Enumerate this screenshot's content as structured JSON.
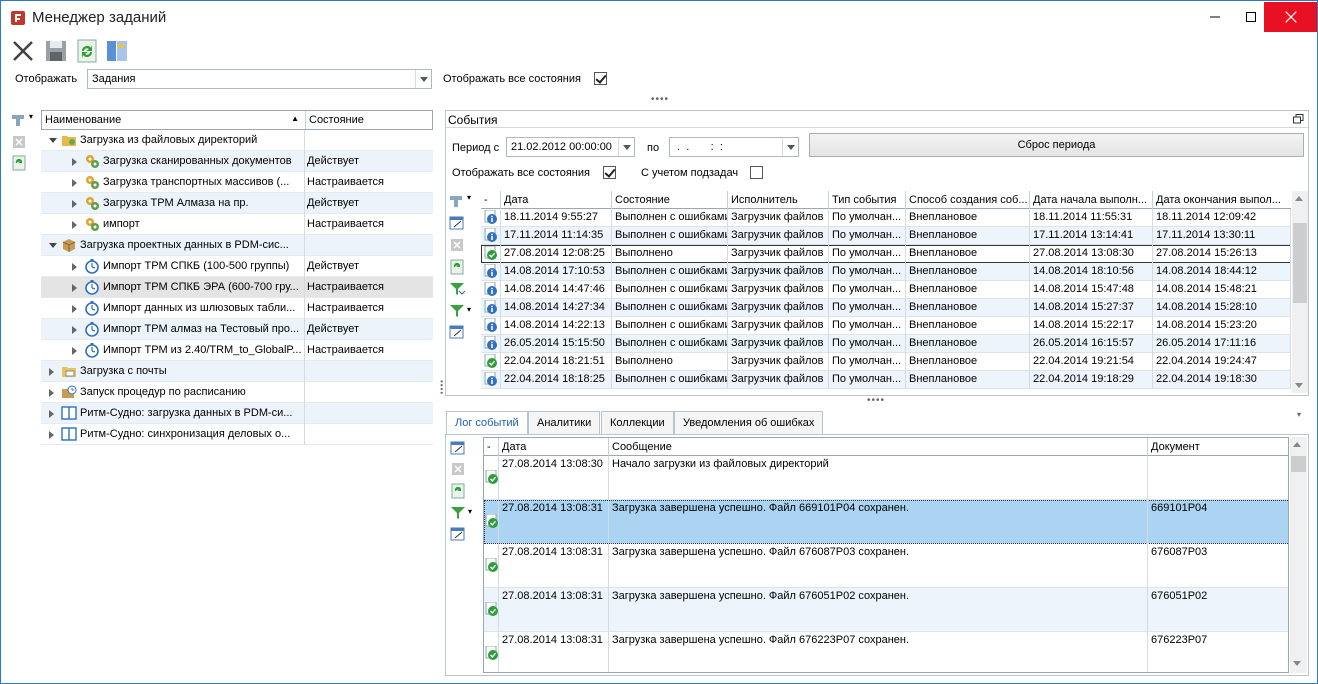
{
  "window": {
    "title": "Менеджер заданий"
  },
  "toolbar": {
    "items": [
      {
        "name": "delete-icon"
      },
      {
        "name": "save-icon"
      },
      {
        "name": "refresh-icon"
      },
      {
        "name": "layout-icon"
      }
    ]
  },
  "display": {
    "label": "Отображать",
    "value": "Задания",
    "all_states_label": "Отображать все состояния",
    "all_states_checked": true
  },
  "tree": {
    "columns": [
      "Наименование",
      "Состояние"
    ],
    "rows": [
      {
        "level": 0,
        "expanded": true,
        "icon": "folder-gear-icon",
        "name": "Загрузка из файловых директорий",
        "state": ""
      },
      {
        "level": 1,
        "expanded": false,
        "icon": "gears-icon",
        "name": "Загрузка сканированных документов",
        "state": "Действует"
      },
      {
        "level": 1,
        "expanded": false,
        "icon": "gears-icon",
        "name": "Загрузка транспортных массивов (...",
        "state": "Настраивается"
      },
      {
        "level": 1,
        "expanded": false,
        "icon": "gears-icon",
        "name": "Загрузка ТРМ Алмаза на пр.",
        "state": "Действует"
      },
      {
        "level": 1,
        "expanded": false,
        "icon": "gears-icon",
        "name": "импорт",
        "state": "Настраивается"
      },
      {
        "level": 0,
        "expanded": true,
        "icon": "package-icon",
        "name": "Загрузка проектных данных в PDM-сис...",
        "state": ""
      },
      {
        "level": 1,
        "expanded": false,
        "icon": "stopwatch-icon",
        "name": "Импорт  ТРМ СПКБ (100-500 группы)",
        "state": "Действует"
      },
      {
        "level": 1,
        "expanded": false,
        "icon": "stopwatch-icon",
        "name": "Импорт  ТРМ СПКБ ЭРА (600-700 гру...",
        "state": "Настраивается",
        "selected": true
      },
      {
        "level": 1,
        "expanded": false,
        "icon": "stopwatch-icon",
        "name": "Импорт данных из шлюзовых табли...",
        "state": "Настраивается"
      },
      {
        "level": 1,
        "expanded": false,
        "icon": "stopwatch-icon",
        "name": "Импорт ТРМ алмаз на Тестовый про...",
        "state": "Действует"
      },
      {
        "level": 1,
        "expanded": false,
        "icon": "stopwatch-icon",
        "name": "Импорт ТРМ из 2.40/TRM_to_GlobalP...",
        "state": "Настраивается"
      },
      {
        "level": 0,
        "expanded": false,
        "icon": "mail-folder-icon",
        "name": "Загрузка с почты",
        "state": ""
      },
      {
        "level": 0,
        "expanded": false,
        "icon": "scheduler-icon",
        "name": "Запуск процедур по расписанию",
        "state": ""
      },
      {
        "level": 0,
        "expanded": false,
        "icon": "book-icon",
        "name": "Ритм-Судно: загрузка данных в PDM-си...",
        "state": ""
      },
      {
        "level": 0,
        "expanded": false,
        "icon": "book-icon",
        "name": "Ритм-Судно: синхронизация деловых о...",
        "state": ""
      }
    ]
  },
  "events": {
    "title": "События",
    "period_from_label": "Период с",
    "period_from_value": "21.02.2012 00:00:00",
    "period_to_label": "по",
    "period_to_value": " .  .       :  :",
    "reset_label": "Сброс периода",
    "all_states_label": "Отображать все состояния",
    "all_states_checked": true,
    "subtasks_label": "С учетом подзадач",
    "subtasks_checked": false,
    "columns": [
      "-",
      "Дата",
      "Состояние",
      "Исполнитель",
      "Тип события",
      "Способ создания соб...",
      "Дата начала выполн...",
      "Дата окончания выпол..."
    ],
    "rows": [
      {
        "icon": "info-icon",
        "date": "18.11.2014 9:55:27",
        "state": "Выполнен с ошибками",
        "executor": "Загрузчик файлов",
        "type": "По умолчан...",
        "method": "Внеплановое",
        "start": "18.11.2014 11:55:31",
        "end": "18.11.2014 12:09:42"
      },
      {
        "icon": "info-icon",
        "date": "17.11.2014 11:14:35",
        "state": "Выполнен с ошибками",
        "executor": "Загрузчик файлов",
        "type": "По умолчан...",
        "method": "Внеплановое",
        "start": "17.11.2014 13:14:41",
        "end": "17.11.2014 13:30:11"
      },
      {
        "icon": "success-icon",
        "date": "27.08.2014 12:08:25",
        "state": "Выполнено",
        "executor": "Загрузчик файлов",
        "type": "По умолчан...",
        "method": "Внеплановое",
        "start": "27.08.2014 13:08:30",
        "end": "27.08.2014 15:26:13",
        "focused": true
      },
      {
        "icon": "info-icon",
        "date": "14.08.2014 17:10:53",
        "state": "Выполнен с ошибками",
        "executor": "Загрузчик файлов",
        "type": "По умолчан...",
        "method": "Внеплановое",
        "start": "14.08.2014 18:10:56",
        "end": "14.08.2014 18:44:12"
      },
      {
        "icon": "info-icon",
        "date": "14.08.2014 14:47:46",
        "state": "Выполнен с ошибками",
        "executor": "Загрузчик файлов",
        "type": "По умолчан...",
        "method": "Внеплановое",
        "start": "14.08.2014 15:47:48",
        "end": "14.08.2014 15:48:21"
      },
      {
        "icon": "info-icon",
        "date": "14.08.2014 14:27:34",
        "state": "Выполнен с ошибками",
        "executor": "Загрузчик файлов",
        "type": "По умолчан...",
        "method": "Внеплановое",
        "start": "14.08.2014 15:27:37",
        "end": "14.08.2014 15:28:10"
      },
      {
        "icon": "info-icon",
        "date": "14.08.2014 14:22:13",
        "state": "Выполнен с ошибками",
        "executor": "Загрузчик файлов",
        "type": "По умолчан...",
        "method": "Внеплановое",
        "start": "14.08.2014 15:22:17",
        "end": "14.08.2014 15:23:20"
      },
      {
        "icon": "info-icon",
        "date": "26.05.2014 15:15:50",
        "state": "Выполнен с ошибками",
        "executor": "Загрузчик файлов",
        "type": "По умолчан...",
        "method": "Внеплановое",
        "start": "26.05.2014 16:15:57",
        "end": "26.05.2014 17:11:16"
      },
      {
        "icon": "success-icon",
        "date": "22.04.2014 18:21:51",
        "state": "Выполнено",
        "executor": "Загрузчик файлов",
        "type": "По умолчан...",
        "method": "Внеплановое",
        "start": "22.04.2014 19:21:54",
        "end": "22.04.2014 19:24:47"
      },
      {
        "icon": "info-icon",
        "date": "22.04.2014 18:18:25",
        "state": "Выполнен с ошибками",
        "executor": "Загрузчик файлов",
        "type": "По умолчан...",
        "method": "Внеплановое",
        "start": "22.04.2014 19:18:29",
        "end": "22.04.2014 19:18:30"
      }
    ]
  },
  "tabs": [
    "Лог событий",
    "Аналитики",
    "Коллекции",
    "Уведомления об ошибках"
  ],
  "log": {
    "columns": [
      "-",
      "Дата",
      "Сообщение",
      "Документ"
    ],
    "rows": [
      {
        "date": "27.08.2014 13:08:30",
        "message": "Начало загрузки из файловых директорий",
        "document": ""
      },
      {
        "date": "27.08.2014 13:08:31",
        "message": "Загрузка завершена успешно. Файл 669101P04 сохранен.",
        "document": "669101P04",
        "selected": true
      },
      {
        "date": "27.08.2014 13:08:31",
        "message": "Загрузка завершена успешно. Файл 676087P03 сохранен.",
        "document": "676087P03"
      },
      {
        "date": "27.08.2014 13:08:31",
        "message": "Загрузка завершена успешно. Файл 676051P02 сохранен.",
        "document": "676051P02"
      },
      {
        "date": "27.08.2014 13:08:31",
        "message": "Загрузка завершена успешно. Файл 676223P07 сохранен.",
        "document": "676223P07"
      }
    ]
  }
}
